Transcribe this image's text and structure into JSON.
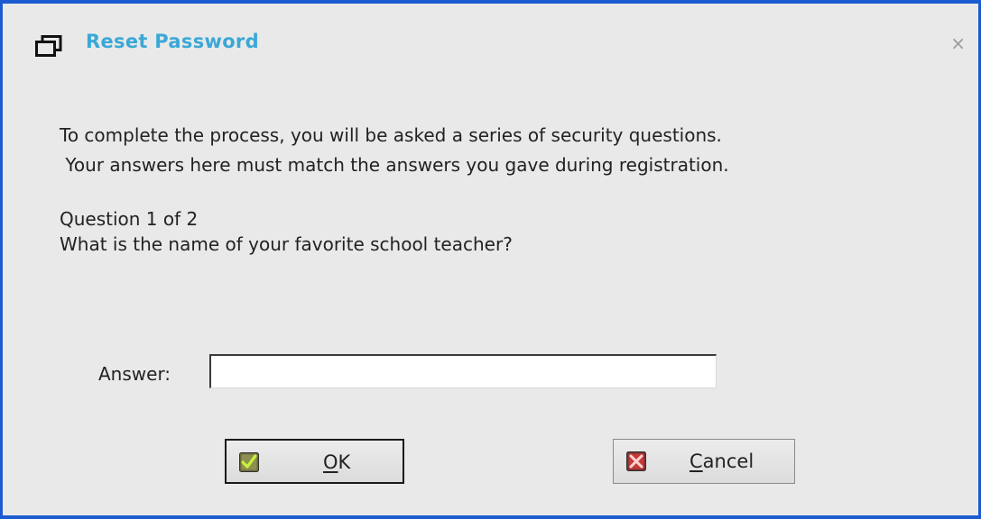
{
  "window": {
    "title": "Reset Password",
    "close_symbol": "×",
    "icon": "window-restore-icon"
  },
  "message": {
    "line1": "To complete the process, you will be asked a series of security questions.",
    "line2": " Your answers here must match the answers you gave during registration."
  },
  "question": {
    "counter": "Question 1 of 2",
    "text": "What is the name of your favorite school teacher?"
  },
  "answer": {
    "label": "Answer:",
    "value": ""
  },
  "buttons": {
    "ok": {
      "mnemonic": "O",
      "rest": "K",
      "icon": "checkmark-icon"
    },
    "cancel": {
      "mnemonic": "C",
      "rest": "ancel",
      "icon": "x-icon"
    }
  },
  "colors": {
    "window_border": "#1c5bd1",
    "title": "#3aa8d6",
    "background": "#e9e9e9"
  }
}
